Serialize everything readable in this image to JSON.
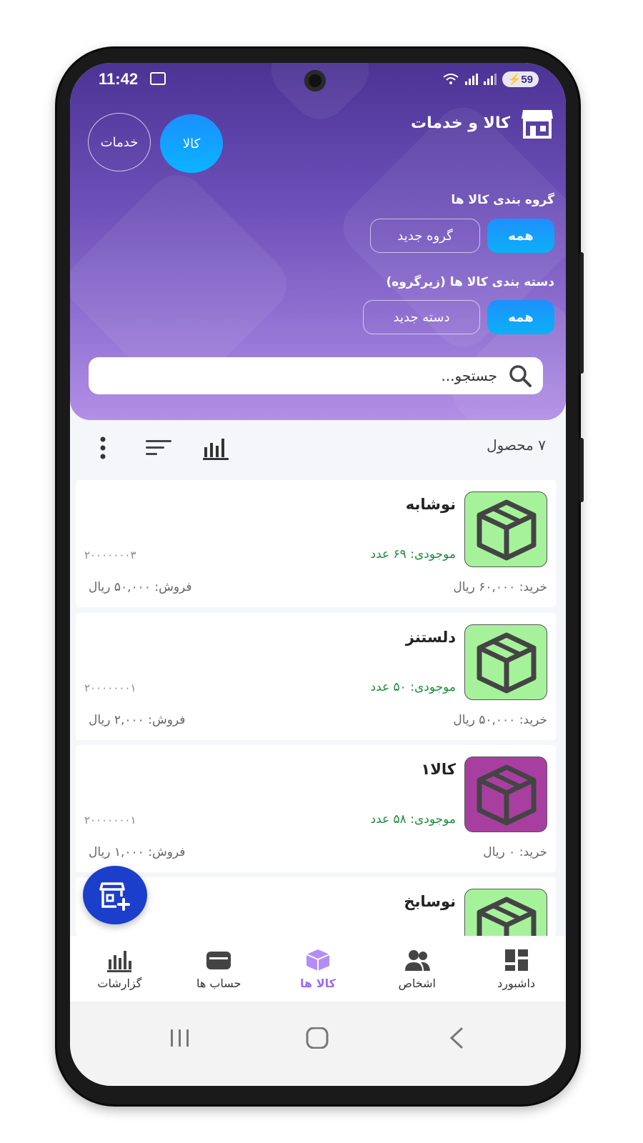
{
  "status_bar": {
    "time": "11:42",
    "battery": "59"
  },
  "header": {
    "title": "کالا و خدمات",
    "toggle_goods": "کالا",
    "toggle_services": "خدمات",
    "group_label": "گروه بندی کالا ها",
    "group_all": "همه",
    "group_new": "گروه جدید",
    "category_label": "دسته بندی کالا ها (زیرگروه)",
    "category_all": "همه",
    "category_new": "دسته جدید",
    "search_placeholder": "جستجو..."
  },
  "toolbar": {
    "count": "۷ محصول"
  },
  "products": [
    {
      "name": "نوشابه",
      "stock": "موجودی: ۶۹ عدد",
      "code": "۲۰۰۰۰۰۰۰۳",
      "buy": "خرید: ۶۰,۰۰۰ ریال",
      "sell": "فروش: ۵۰,۰۰۰ ریال",
      "thumb_color": "#a6f29b"
    },
    {
      "name": "دلستنز",
      "stock": "موجودی: ۵۰ عدد",
      "code": "۲۰۰۰۰۰۰۰۱",
      "buy": "خرید: ۵۰,۰۰۰ ریال",
      "sell": "فروش: ۲,۰۰۰ ریال",
      "thumb_color": "#a6f29b"
    },
    {
      "name": "کالا۱",
      "stock": "موجودی: ۵۸ عدد",
      "code": "۲۰۰۰۰۰۰۰۱",
      "buy": "خرید: ۰ ریال",
      "sell": "فروش: ۱,۰۰۰ ریال",
      "thumb_color": "#a83fa0"
    },
    {
      "name": "نوسابخ",
      "thumb_color": "#a6f29b"
    }
  ],
  "bottom_nav": {
    "dashboard": "داشبورد",
    "people": "اشخاص",
    "products": "کالا ها",
    "accounts": "حساب ها",
    "reports": "گزارشات"
  },
  "colors": {
    "accent": "#9b6cf0",
    "primary_blue": "#1b8fff",
    "stock_green": "#1f8a3c",
    "fab": "#1b3ecb"
  }
}
